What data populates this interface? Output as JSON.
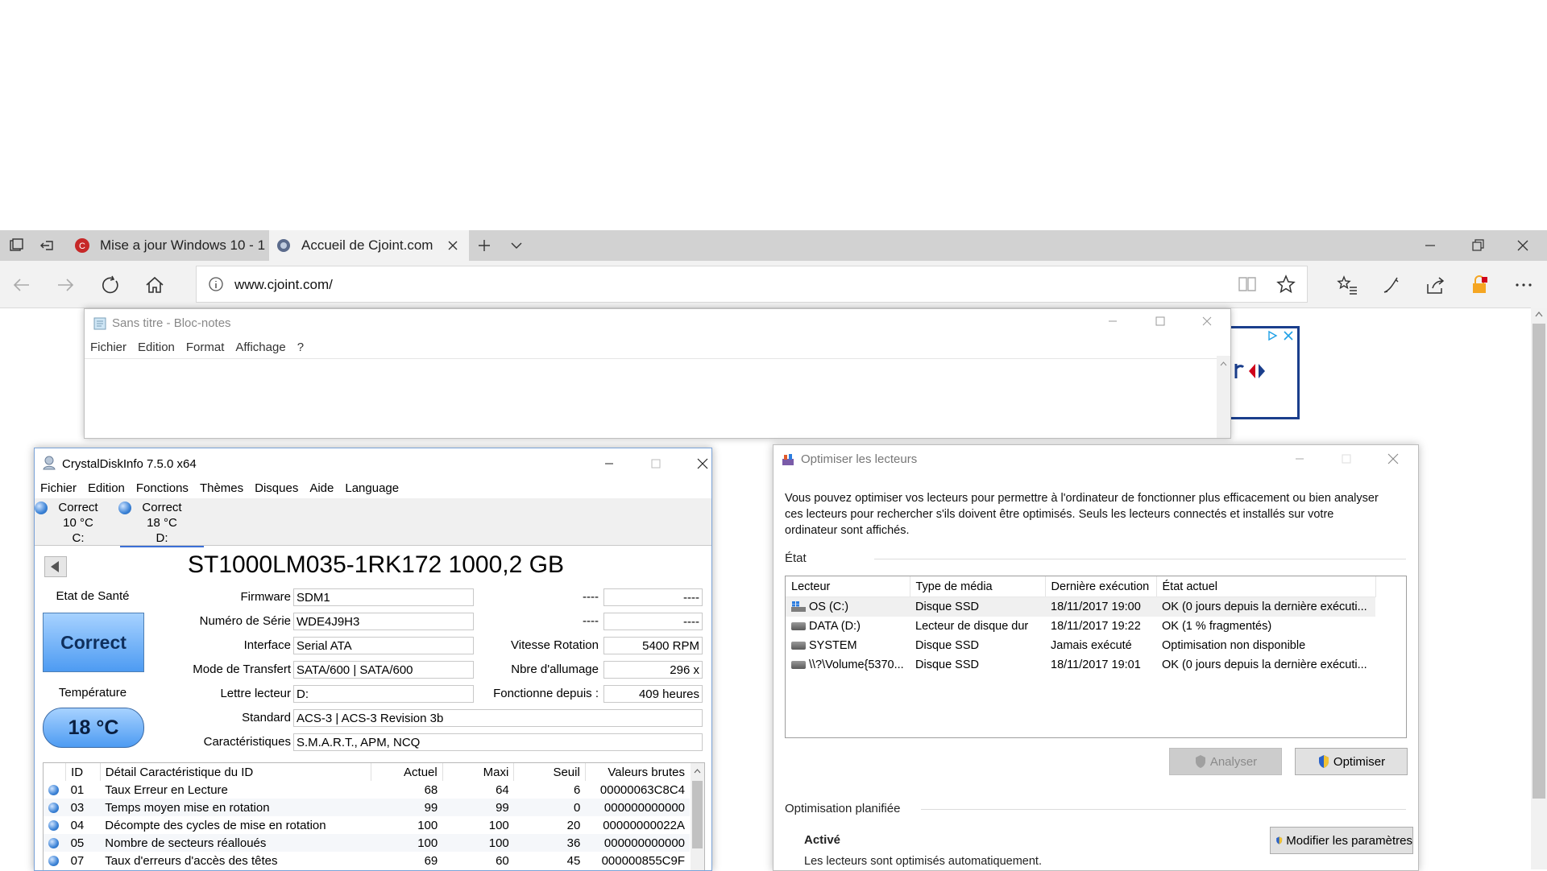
{
  "browser": {
    "tabs": [
      {
        "title": "Mise a jour Windows 10 - 1"
      },
      {
        "title": "Accueil de Cjoint.com"
      }
    ],
    "url": "www.cjoint.com/"
  },
  "notepad": {
    "title": "Sans titre - Bloc-notes",
    "menu": [
      "Fichier",
      "Edition",
      "Format",
      "Affichage",
      "?"
    ]
  },
  "crystal": {
    "title": "CrystalDiskInfo 7.5.0 x64",
    "menu": [
      "Fichier",
      "Edition",
      "Fonctions",
      "Thèmes",
      "Disques",
      "Aide",
      "Language"
    ],
    "drives": [
      {
        "status": "Correct",
        "temp": "10 °C",
        "letter": "C:"
      },
      {
        "status": "Correct",
        "temp": "18 °C",
        "letter": "D:"
      }
    ],
    "model": "ST1000LM035-1RK172 1000,2 GB",
    "health_label": "Etat de Santé",
    "health_value": "Correct",
    "temp_label": "Température",
    "temp_value": "18 °C",
    "fields": {
      "firmware_label": "Firmware",
      "firmware": "SDM1",
      "serial_label": "Numéro de Série",
      "serial": "WDE4J9H3",
      "interface_label": "Interface",
      "interface": "Serial ATA",
      "transfer_label": "Mode de Transfert",
      "transfer": "SATA/600 | SATA/600",
      "letter_label": "Lettre lecteur",
      "letter": "D:",
      "standard_label": "Standard",
      "standard": "ACS-3 | ACS-3 Revision 3b",
      "features_label": "Caractéristiques",
      "features": "S.M.A.R.T., APM, NCQ",
      "r1_label": "----",
      "r1": "----",
      "r2_label": "----",
      "r2": "----",
      "rotation_label": "Vitesse Rotation",
      "rotation": "5400 RPM",
      "power_count_label": "Nbre d'allumage",
      "power_count": "296 x",
      "power_hours_label": "Fonctionne depuis :",
      "power_hours": "409 heures"
    },
    "smart_headers": [
      "ID",
      "Détail Caractéristique du ID",
      "Actuel",
      "Maxi",
      "Seuil",
      "Valeurs brutes"
    ],
    "smart_rows": [
      {
        "id": "01",
        "name": "Taux Erreur en Lecture",
        "cur": "68",
        "max": "64",
        "thr": "6",
        "raw": "00000063C8C4"
      },
      {
        "id": "03",
        "name": "Temps moyen mise en rotation",
        "cur": "99",
        "max": "99",
        "thr": "0",
        "raw": "000000000000"
      },
      {
        "id": "04",
        "name": "Décompte des cycles de mise en rotation",
        "cur": "100",
        "max": "100",
        "thr": "20",
        "raw": "00000000022A"
      },
      {
        "id": "05",
        "name": "Nombre de secteurs réalloués",
        "cur": "100",
        "max": "100",
        "thr": "36",
        "raw": "000000000000"
      },
      {
        "id": "07",
        "name": "Taux d'erreurs d'accès des têtes",
        "cur": "69",
        "max": "60",
        "thr": "45",
        "raw": "000000855C9F"
      }
    ]
  },
  "optimizer": {
    "title": "Optimiser les lecteurs",
    "description": "Vous pouvez optimiser vos lecteurs pour permettre à l'ordinateur de fonctionner plus efficacement ou bien analyser ces lecteurs pour rechercher s'ils doivent être optimisés. Seuls les lecteurs connectés et installés sur votre ordinateur sont affichés.",
    "state_label": "État",
    "columns": [
      "Lecteur",
      "Type de média",
      "Dernière exécution",
      "État actuel"
    ],
    "rows": [
      {
        "drive": "OS (C:)",
        "media": "Disque SSD",
        "last": "18/11/2017 19:00",
        "status": "OK (0 jours depuis la dernière exécuti..."
      },
      {
        "drive": "DATA (D:)",
        "media": "Lecteur de disque dur",
        "last": "18/11/2017 19:22",
        "status": "OK (1 % fragmentés)"
      },
      {
        "drive": "SYSTEM",
        "media": "Disque SSD",
        "last": "Jamais exécuté",
        "status": "Optimisation non disponible"
      },
      {
        "drive": "\\\\?\\Volume{5370...",
        "media": "Disque SSD",
        "last": "18/11/2017 19:01",
        "status": "OK (0 jours depuis la dernière exécuti..."
      }
    ],
    "analyze_label": "Analyser",
    "optimize_label": "Optimiser",
    "scheduled_label": "Optimisation planifiée",
    "modify_label": "Modifier les paramètres",
    "active_label": "Activé",
    "active_desc": "Les lecteurs sont optimisés automatiquement."
  }
}
